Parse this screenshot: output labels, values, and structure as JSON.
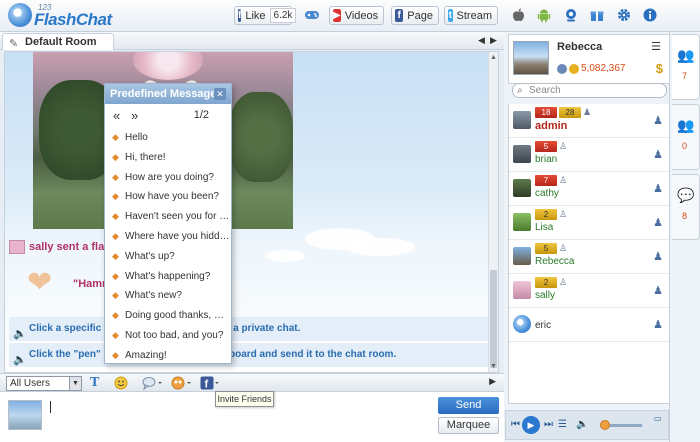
{
  "app": {
    "logo_num": "123",
    "logo_name": "FlashChat"
  },
  "topbar": {
    "like_label": "Like",
    "like_count": "6.2k",
    "videos_label": "Videos",
    "page_label": "Page",
    "stream_label": "Stream"
  },
  "room": {
    "tab_label": "Default Room"
  },
  "chat": {
    "flash_msg": "sally sent a flash",
    "hamm_msg": "\"Hamm",
    "sys1": "Click a specific use",
    "sys1b": "t a private chat.",
    "sys2": "Click the \"pen\" icon",
    "sys2b": "board and send it to the chat room."
  },
  "predefined": {
    "title": "Predefined Messages",
    "close": "✕",
    "prev": "«",
    "next": "»",
    "page": "1/2",
    "items": [
      "Hello",
      "Hi, there!",
      "How are you doing?",
      "How have you been?",
      "Haven't seen you for a...",
      "Where have you hidde...",
      "What's up?",
      "What's happening?",
      "What's new?",
      "Doing good thanks, wh...",
      "Not too bad, and you?",
      "Amazing!"
    ]
  },
  "toolbar": {
    "user_select": "All Users",
    "tooltip": "Invite Friends"
  },
  "input": {
    "send_label": "Send",
    "marquee_label": "Marquee"
  },
  "profile": {
    "name": "Rebecca",
    "credits": "5,082,367",
    "coin": "$"
  },
  "search": {
    "placeholder": "Search"
  },
  "users": [
    {
      "name": "admin",
      "level": "18",
      "gold": "28",
      "admin": true,
      "color": "#b5261c"
    },
    {
      "name": "brian",
      "level": "5",
      "gold": "",
      "admin": false,
      "color": "#2a7a2a"
    },
    {
      "name": "cathy",
      "level": "7",
      "gold": "",
      "admin": false,
      "color": "#2a7a2a"
    },
    {
      "name": "Lisa",
      "level": "",
      "gold": "2",
      "admin": false,
      "color": "#2a7a2a"
    },
    {
      "name": "Rebecca",
      "level": "",
      "gold": "5",
      "admin": false,
      "color": "#2a7a2a"
    },
    {
      "name": "sally",
      "level": "",
      "gold": "2",
      "admin": false,
      "color": "#2a7a2a"
    },
    {
      "name": "eric",
      "level": "",
      "gold": "",
      "admin": false,
      "color": "#333333"
    }
  ],
  "side": {
    "tab1_count": "7",
    "tab2_count": "0",
    "tab3_count": "8"
  }
}
